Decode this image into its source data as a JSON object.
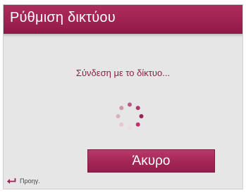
{
  "dialog": {
    "title": "Ρύθμιση δικτύου",
    "message": "Σύνδεση με το δίκτυο...",
    "cancel_label": "Άκυρο"
  },
  "footer": {
    "back_label": "Προηγ.",
    "back_icon": "back-arrow-icon"
  },
  "spinner": {
    "icon": "loading-spinner-icon"
  },
  "colors": {
    "accent": "#9e2151",
    "background": "#e6e6e6",
    "message_text": "#8c1f46"
  }
}
